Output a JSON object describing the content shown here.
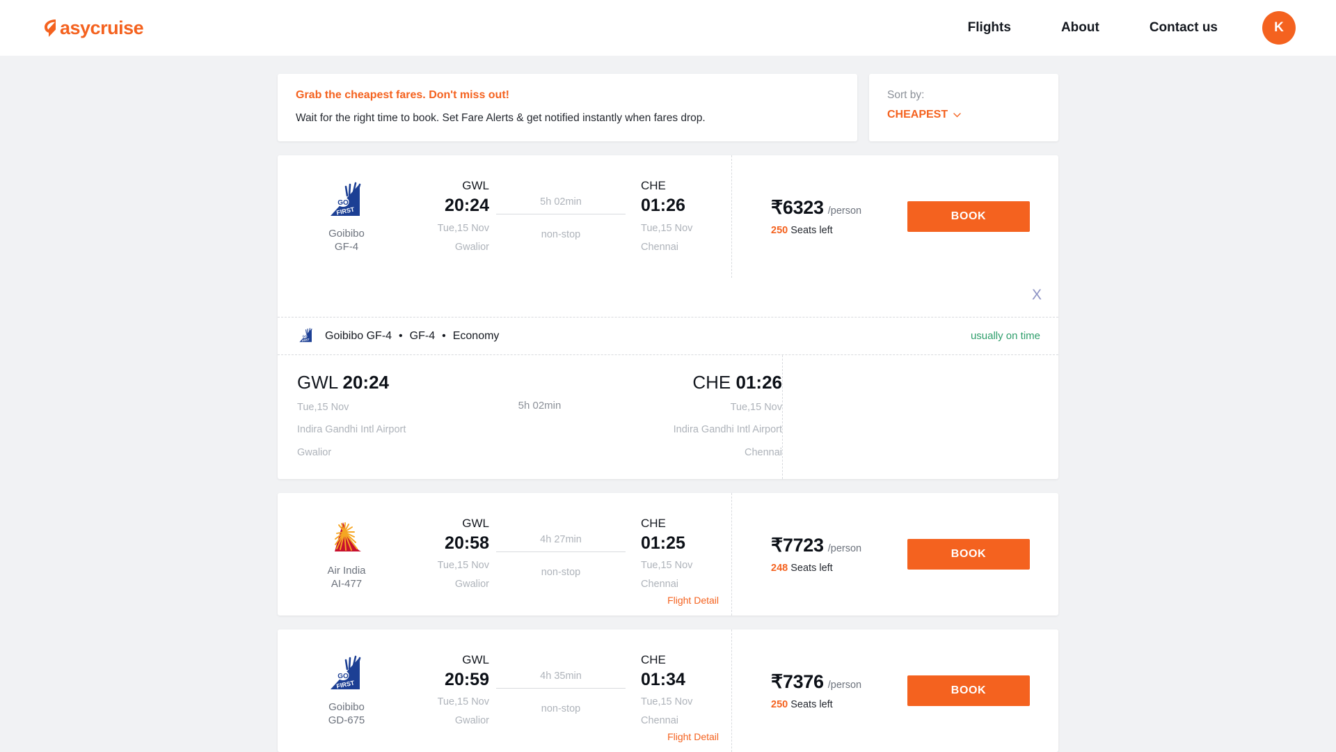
{
  "header": {
    "logo_text": "asycruise",
    "logo_icon": "easycruise-e-icon",
    "nav": [
      {
        "label": "Flights"
      },
      {
        "label": "About"
      },
      {
        "label": "Contact us"
      }
    ],
    "avatar_initial": "K"
  },
  "fare_alert": {
    "title": "Grab the cheapest fares. Don't miss out!",
    "subtitle": "Wait for the right time to book. Set Fare Alerts & get notified instantly when fares drop."
  },
  "sort": {
    "label": "Sort by:",
    "value": "CHEAPEST",
    "icon": "chevron-down-icon"
  },
  "colors": {
    "accent": "#f4621f",
    "page_bg": "#f1f2f4",
    "card_bg": "#ffffff",
    "muted": "#aeb3ba",
    "ontime_green": "#2e9e6b",
    "goibibo_blue": "#1c3f94",
    "airindia_red": "#c8102e"
  },
  "flights": [
    {
      "airline": "Goibibo",
      "logo": "go-first-logo",
      "flight_code": "GF-4",
      "depart_iata": "GWL",
      "depart_time": "20:24",
      "depart_date": "Tue,15 Nov",
      "depart_city": "Gwalior",
      "duration": "5h 02min",
      "stops": "non-stop",
      "arrive_iata": "CHE",
      "arrive_time": "01:26",
      "arrive_date": "Tue,15 Nov",
      "arrive_city": "Chennai",
      "price": "₹6323",
      "per_person": "/person",
      "seats_count": "250",
      "seats_text": "Seats left",
      "book_label": "BOOK",
      "detail_link": "",
      "expanded": true
    },
    {
      "airline": "Air India",
      "logo": "air-india-logo",
      "flight_code": "AI-477",
      "depart_iata": "GWL",
      "depart_time": "20:58",
      "depart_date": "Tue,15 Nov",
      "depart_city": "Gwalior",
      "duration": "4h 27min",
      "stops": "non-stop",
      "arrive_iata": "CHE",
      "arrive_time": "01:25",
      "arrive_date": "Tue,15 Nov",
      "arrive_city": "Chennai",
      "price": "₹7723",
      "per_person": "/person",
      "seats_count": "248",
      "seats_text": "Seats left",
      "book_label": "BOOK",
      "detail_link": "Flight Detail",
      "expanded": false
    },
    {
      "airline": "Goibibo",
      "logo": "go-first-logo",
      "flight_code": "GD-675",
      "depart_iata": "GWL",
      "depart_time": "20:59",
      "depart_date": "Tue,15 Nov",
      "depart_city": "Gwalior",
      "duration": "4h 35min",
      "stops": "non-stop",
      "arrive_iata": "CHE",
      "arrive_time": "01:34",
      "arrive_date": "Tue,15 Nov",
      "arrive_city": "Chennai",
      "price": "₹7376",
      "per_person": "/person",
      "seats_count": "250",
      "seats_text": "Seats left",
      "book_label": "BOOK",
      "detail_link": "Flight Detail",
      "expanded": false
    }
  ],
  "expanded_detail": {
    "close_label": "X",
    "airline_flight": "Goibibo GF-4",
    "flight_code": "GF-4",
    "cabin_class": "Economy",
    "status": "usually on time",
    "depart_iata": "GWL",
    "depart_time": "20:24",
    "depart_date": "Tue,15 Nov",
    "depart_airport": "Indira Gandhi Intl Airport",
    "depart_city": "Gwalior",
    "duration": "5h 02min",
    "arrive_iata": "CHE",
    "arrive_time": "01:26",
    "arrive_date": "Tue,15 Nov",
    "arrive_airport": "Indira Gandhi Intl Airport",
    "arrive_city": "Chennai"
  }
}
